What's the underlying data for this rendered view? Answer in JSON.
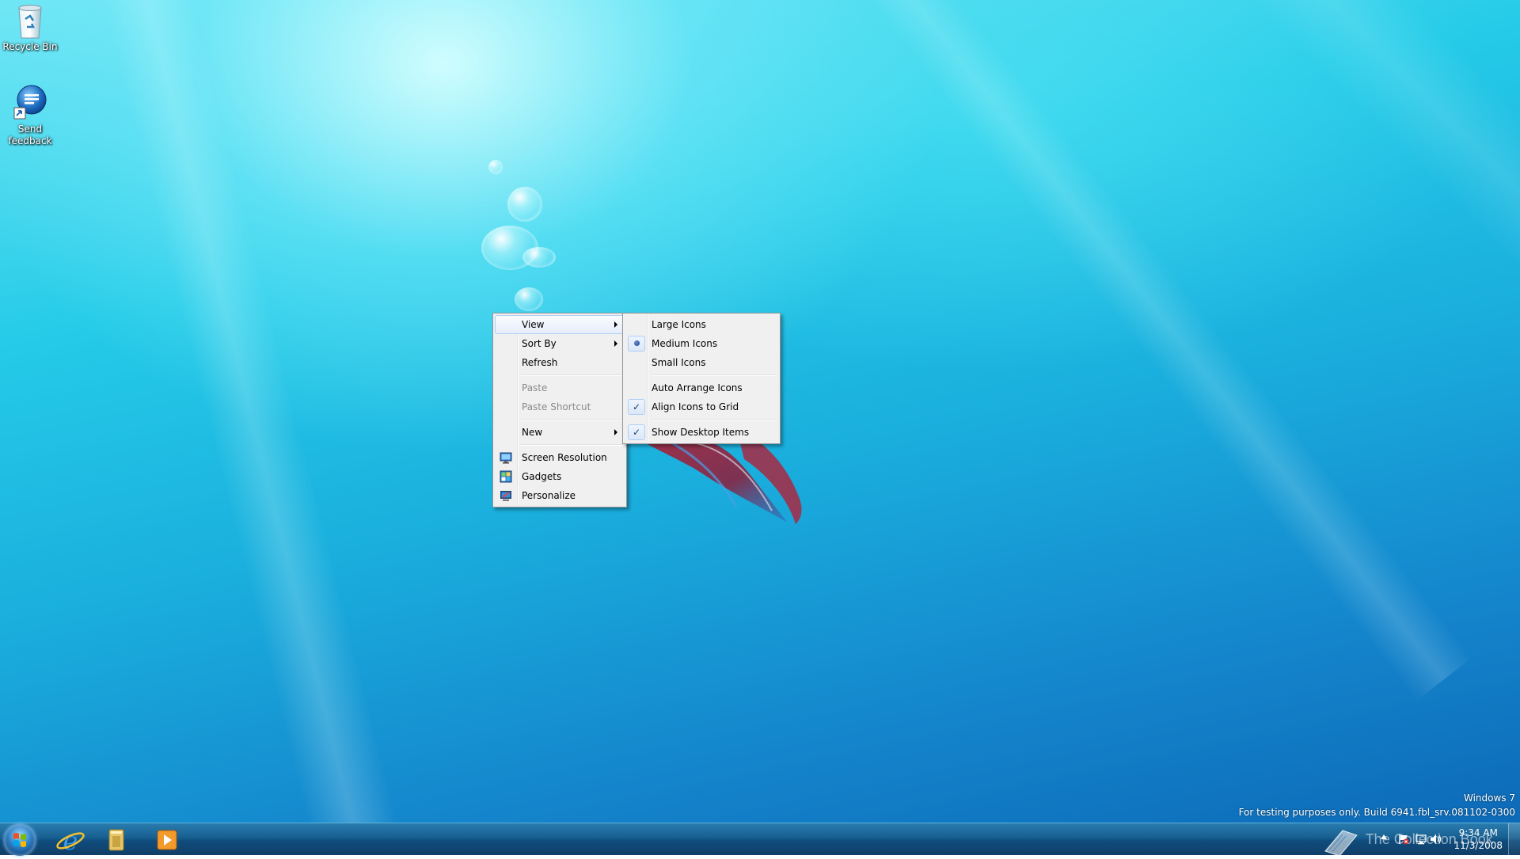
{
  "desktop": {
    "icons": [
      {
        "label": "Recycle Bin",
        "icon": "recycle-bin-icon"
      },
      {
        "label": "Send feedback",
        "icon": "send-feedback-icon"
      }
    ]
  },
  "context_menu": {
    "items": [
      {
        "label": "View",
        "submenu": true,
        "highlighted": true
      },
      {
        "label": "Sort By",
        "submenu": true
      },
      {
        "label": "Refresh"
      },
      {
        "label": "Paste",
        "disabled": true
      },
      {
        "label": "Paste Shortcut",
        "disabled": true
      },
      {
        "label": "New",
        "submenu": true
      },
      {
        "label": "Screen Resolution",
        "icon": "screen-resolution-icon"
      },
      {
        "label": "Gadgets",
        "icon": "gadgets-icon"
      },
      {
        "label": "Personalize",
        "icon": "personalize-icon"
      }
    ]
  },
  "view_submenu": {
    "items": [
      {
        "label": "Large Icons"
      },
      {
        "label": "Medium Icons",
        "mark": "radio-dot"
      },
      {
        "label": "Small Icons"
      },
      {
        "label": "Auto Arrange Icons"
      },
      {
        "label": "Align Icons to Grid",
        "mark": "checkmark"
      },
      {
        "label": "Show Desktop Items",
        "mark": "checkmark"
      }
    ],
    "check_glyph": "✓"
  },
  "watermark": {
    "line1": "Windows 7",
    "line2": "For testing purposes only. Build 6941.fbl_srv.081102-0300"
  },
  "taskbar": {
    "pinned": [
      {
        "name": "internet-explorer-icon"
      },
      {
        "name": "windows-explorer-icon"
      },
      {
        "name": "media-player-icon"
      }
    ],
    "overlay_text": "The Collection Book",
    "clock": {
      "time": "9:34 AM",
      "date": "11/3/2008"
    }
  },
  "colors": {
    "desktop_light": "#6fe6f4",
    "desktop_dark": "#0d6ab8",
    "menu_bg": "#f0f0f0",
    "menu_highlight_border": "#aecff7",
    "taskbar": "#185f91"
  }
}
